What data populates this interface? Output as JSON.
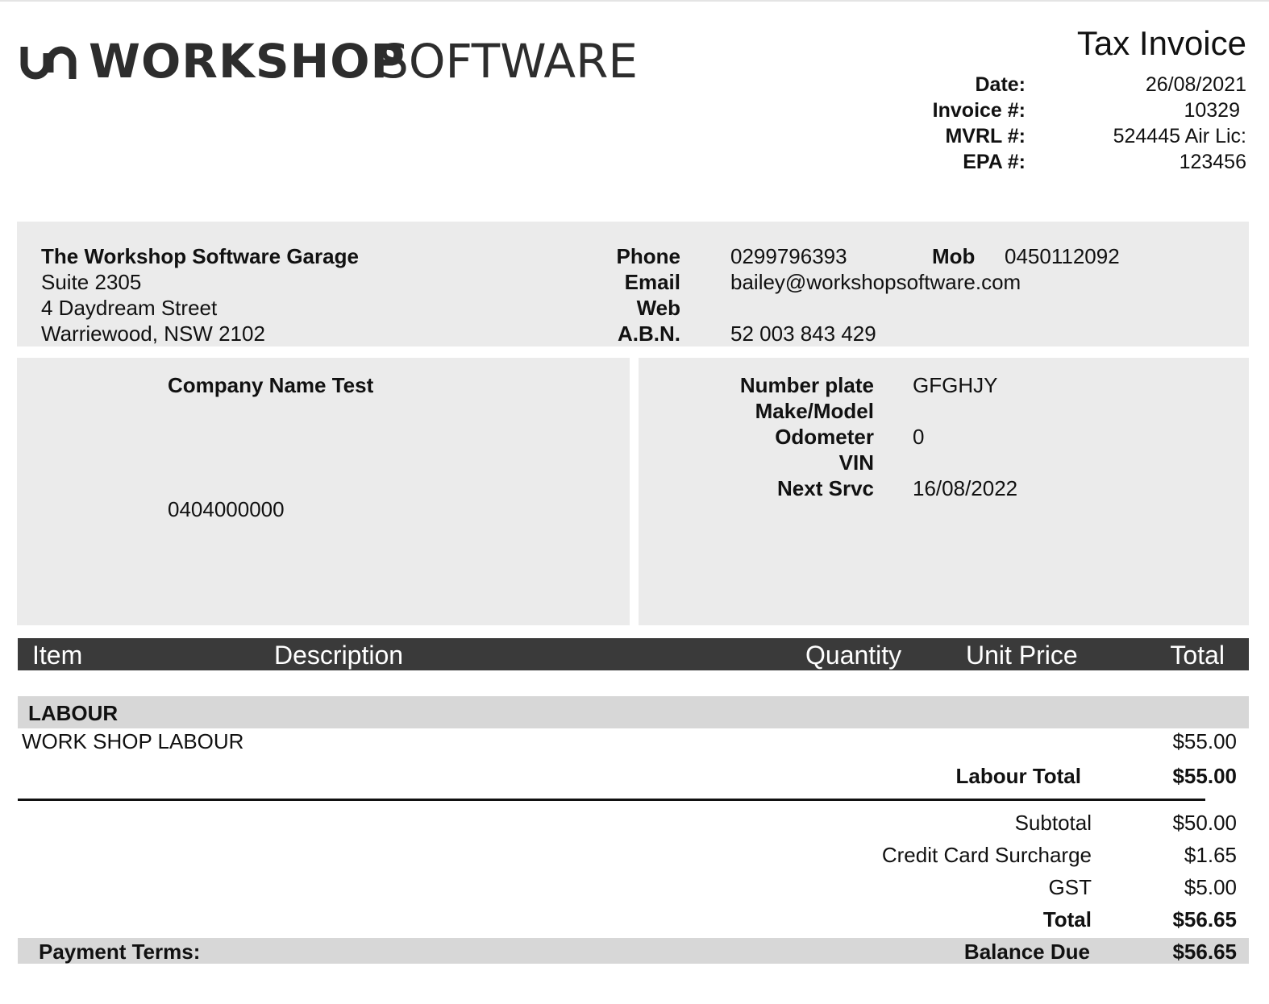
{
  "brand": {
    "name_bold": "WORKSHOP",
    "name_light": "SOFTWARE",
    "icon": "workshop-logo-mark"
  },
  "doc": {
    "title": "Tax Invoice",
    "meta": [
      {
        "label": "Date:",
        "value": "26/08/2021"
      },
      {
        "label": "Invoice #:",
        "value": "10329"
      },
      {
        "label": "MVRL #:",
        "value": "524445 Air Lic:"
      },
      {
        "label": "EPA #:",
        "value": "123456"
      }
    ]
  },
  "business": {
    "name": "The Workshop Software Garage",
    "address": [
      "Suite 2305",
      "4 Daydream Street",
      "Warriewood, NSW 2102"
    ],
    "contact_labels": {
      "phone": "Phone",
      "email": "Email",
      "web": "Web",
      "abn": "A.B.N.",
      "mob": "Mob"
    },
    "phone": "0299796393",
    "mob": "0450112092",
    "email": "bailey@workshopsoftware.com",
    "web": "",
    "abn": "52 003 843 429"
  },
  "customer": {
    "name": "Company Name Test",
    "phone": "0404000000"
  },
  "vehicle": {
    "labels": {
      "plate": "Number plate",
      "make": "Make/Model",
      "odometer": "Odometer",
      "vin": "VIN",
      "next": "Next Srvc"
    },
    "plate": "GFGHJY",
    "make": "",
    "odometer": "0",
    "vin": "",
    "next": "16/08/2022"
  },
  "table": {
    "headers": {
      "item": "Item",
      "description": "Description",
      "quantity": "Quantity",
      "unit_price": "Unit Price",
      "total": "Total"
    },
    "section": "LABOUR",
    "line": {
      "description": "WORK SHOP LABOUR",
      "total": "$55.00"
    },
    "section_total_label": "Labour Total",
    "section_total_value": "$55.00"
  },
  "totals": {
    "subtotal_label": "Subtotal",
    "subtotal": "$50.00",
    "surcharge_label": "Credit Card Surcharge",
    "surcharge": "$1.65",
    "gst_label": "GST",
    "gst": "$5.00",
    "total_label": "Total",
    "total": "$56.65"
  },
  "footer": {
    "payment_terms_label": "Payment Terms:",
    "balance_label": "Balance Due",
    "balance": "$56.65"
  },
  "colors": {
    "panel": "#ebebeb",
    "header_bar": "#3a3a3a",
    "section_bar": "#d7d7d7",
    "logo": "#2d2d2d"
  }
}
